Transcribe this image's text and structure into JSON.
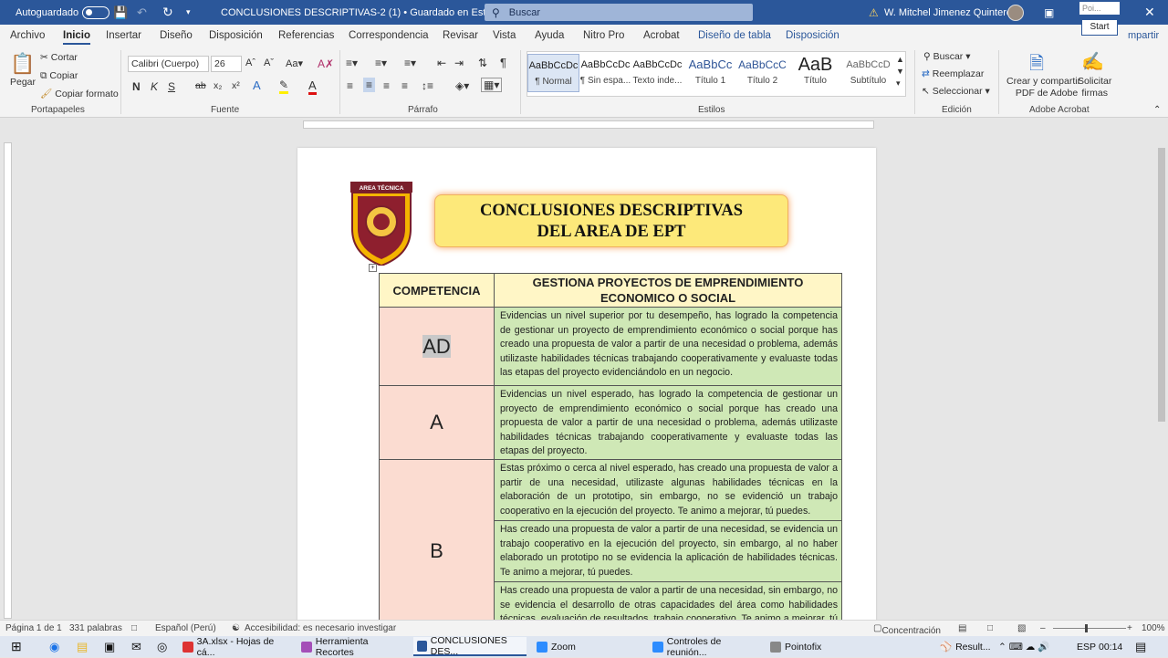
{
  "titlebar": {
    "autosave": "Autoguardado",
    "doc_title": "CONCLUSIONES DESCRIPTIVAS-2 (1)",
    "save_status": "• Guardado en Este PC",
    "search": "Buscar",
    "user": "W. Mitchel Jimenez Quinteros",
    "pointofix_label": "Poi...",
    "start": "Start",
    "share": "mpartir"
  },
  "tabs": [
    "Archivo",
    "Inicio",
    "Insertar",
    "Diseño",
    "Disposición",
    "Referencias",
    "Correspondencia",
    "Revisar",
    "Vista",
    "Ayuda",
    "Nitro Pro",
    "Acrobat",
    "Diseño de tabla",
    "Disposición"
  ],
  "ribbon": {
    "clipboard": {
      "paste": "Pegar",
      "cut": "Cortar",
      "copy": "Copiar",
      "format": "Copiar formato",
      "label": "Portapapeles"
    },
    "font": {
      "name": "Calibri (Cuerpo)",
      "size": "26",
      "label": "Fuente",
      "bold": "N",
      "italic": "K",
      "underline": "S"
    },
    "paragraph": {
      "label": "Párrafo"
    },
    "styles": {
      "items": [
        {
          "preview": "AaBbCcDc",
          "name": "¶ Normal"
        },
        {
          "preview": "AaBbCcDc",
          "name": "¶ Sin espa..."
        },
        {
          "preview": "AaBbCcDc",
          "name": "Texto inde..."
        },
        {
          "preview": "AaBbCc",
          "name": "Título 1"
        },
        {
          "preview": "AaBbCcC",
          "name": "Título 2"
        },
        {
          "preview": "AaB",
          "name": "Título"
        },
        {
          "preview": "AaBbCcD",
          "name": "Subtítulo"
        }
      ],
      "label": "Estilos"
    },
    "editing": {
      "find": "Buscar",
      "replace": "Reemplazar",
      "select": "Seleccionar",
      "label": "Edición"
    },
    "acrobat": {
      "create": "Crear y compartir",
      "create2": "PDF de Adobe",
      "sign": "Solicitar",
      "sign2": "firmas",
      "label": "Adobe Acrobat"
    }
  },
  "document": {
    "logo_text": "AREA TÉCNICA",
    "banner_line1": "CONCLUSIONES DESCRIPTIVAS",
    "banner_line2": "DEL AREA DE EPT",
    "col1_header": "COMPETENCIA",
    "col2_header": "GESTIONA PROYECTOS DE EMPRENDIMIENTO ECONOMICO O SOCIAL",
    "rows": [
      {
        "level": "AD",
        "text": "Evidencias un nivel superior por tu desempeño, has logrado la competencia de gestionar un proyecto de emprendimiento económico o social porque has creado una propuesta de valor a partir de una necesidad o problema, además utilizaste habilidades técnicas trabajando cooperativamente y evaluaste todas las etapas del proyecto evidenciándolo en un negocio."
      },
      {
        "level": "A",
        "text": "Evidencias un nivel esperado, has logrado la competencia de gestionar un proyecto de emprendimiento económico o social porque has creado una propuesta de valor a partir de una necesidad o problema, además utilizaste habilidades técnicas trabajando cooperativamente y evaluaste todas las etapas del proyecto."
      },
      {
        "level": "B",
        "texts": [
          "Estas próximo o cerca al nivel esperado, has creado una propuesta de valor a partir de una necesidad, utilizaste algunas habilidades técnicas en la elaboración de un prototipo, sin embargo, no se evidenció un trabajo cooperativo en la ejecución del proyecto. Te animo a mejorar, tú puedes.",
          "Has creado una propuesta de valor a partir de una necesidad, se evidencia un trabajo cooperativo en la ejecución del proyecto, sin embargo, al no haber elaborado un prototipo no se evidencia la aplicación de habilidades técnicas. Te animo a mejorar, tú puedes.",
          "Has creado una propuesta de valor a partir de una necesidad, sin embargo, no se evidencia el desarrollo de otras capacidades del área como habilidades técnicas, evaluación de resultados, trabajo cooperativo. Te animo a mejorar, tú puedes."
        ]
      }
    ]
  },
  "status": {
    "page": "Página 1 de 1",
    "words": "331 palabras",
    "language": "Español (Perú)",
    "accessibility": "Accesibilidad: es necesario investigar",
    "focus": "Concentración",
    "zoom": "100%"
  },
  "taskbar": {
    "items": [
      "3A.xlsx - Hojas de cá...",
      "Herramienta Recortes",
      "CONCLUSIONES DES...",
      "Zoom",
      "Controles de reunión...",
      "Pointofix"
    ],
    "results": "Result...",
    "lang": "ESP",
    "time": "00:14"
  }
}
